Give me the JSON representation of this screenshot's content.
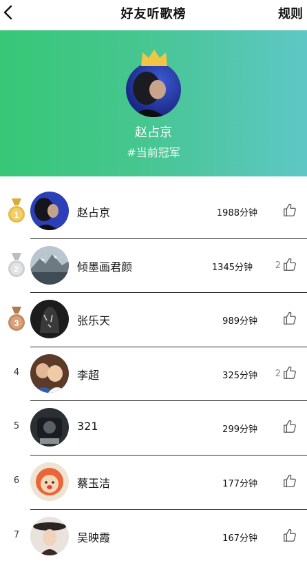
{
  "header": {
    "title": "好友听歌榜",
    "rules_label": "规则",
    "back_icon": "chevron-left-icon"
  },
  "banner": {
    "champion_name": "赵占京",
    "champion_tag": "#当前冠军",
    "gradient_start": "#37c777",
    "gradient_end": "#5ec7c6"
  },
  "ranking": [
    {
      "rank": "1",
      "medal": "gold",
      "name": "赵占京",
      "minutes": "1988分钟",
      "likes": ""
    },
    {
      "rank": "2",
      "medal": "silver",
      "name": "倾墨画君颜",
      "minutes": "1345分钟",
      "likes": "2"
    },
    {
      "rank": "3",
      "medal": "bronze",
      "name": "张乐天",
      "minutes": "989分钟",
      "likes": ""
    },
    {
      "rank": "4",
      "medal": "",
      "name": "李超",
      "minutes": "325分钟",
      "likes": "2"
    },
    {
      "rank": "5",
      "medal": "",
      "name": "321",
      "minutes": "299分钟",
      "likes": ""
    },
    {
      "rank": "6",
      "medal": "",
      "name": "蔡玉洁",
      "minutes": "177分钟",
      "likes": ""
    },
    {
      "rank": "7",
      "medal": "",
      "name": "吴映霞",
      "minutes": "167分钟",
      "likes": ""
    }
  ]
}
